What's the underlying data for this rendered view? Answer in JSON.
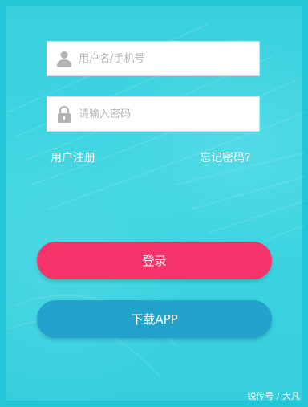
{
  "form": {
    "username_placeholder": "用户名/手机号",
    "password_placeholder": "请输入密码",
    "username_icon": "user-icon",
    "password_icon": "lock-icon"
  },
  "links": {
    "register": "用户注册",
    "forgot_password": "忘记密码?"
  },
  "buttons": {
    "login": "登录",
    "download_app": "下载APP"
  },
  "watermark": "锐传号 / 大凡",
  "colors": {
    "background": "#3fd6e2",
    "login_button": "#f5346a",
    "download_button": "#22a3cc",
    "icon_gray": "#b3b3b3"
  }
}
